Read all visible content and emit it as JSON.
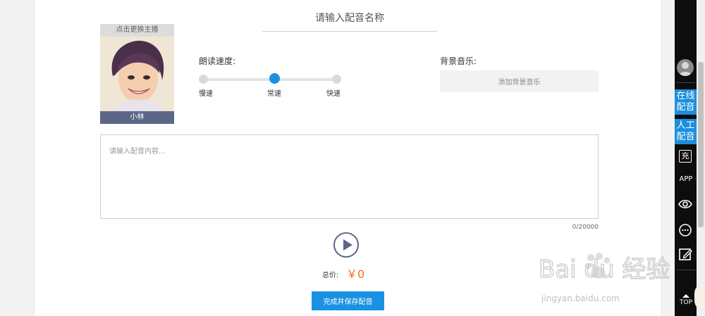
{
  "title_input": {
    "placeholder": "请输入配音名称"
  },
  "anchor": {
    "change_label": "点击更换主播",
    "name": "小林"
  },
  "speed": {
    "label": "朗读速度:",
    "options": [
      "慢速",
      "常速",
      "快速"
    ],
    "selected": "常速"
  },
  "bgm": {
    "label": "背景音乐:",
    "button": "添加背景音乐"
  },
  "content": {
    "placeholder": "请输入配音内容...",
    "count": "0/20000"
  },
  "price": {
    "label": "总价:",
    "value": "￥0"
  },
  "save_button": "完成并保存配音",
  "sidebar": {
    "online_line1": "在线",
    "online_line2": "配音",
    "manual_line1": "人工",
    "manual_line2": "配音",
    "charge": "充",
    "app": "APP",
    "top": "TOP"
  },
  "watermark": {
    "brand": "Bai du 经验",
    "url": "jingyan.baidu.com"
  },
  "colors": {
    "accent": "#1a92e3",
    "price": "#ff6a1a",
    "name_bar": "#5c6788"
  }
}
